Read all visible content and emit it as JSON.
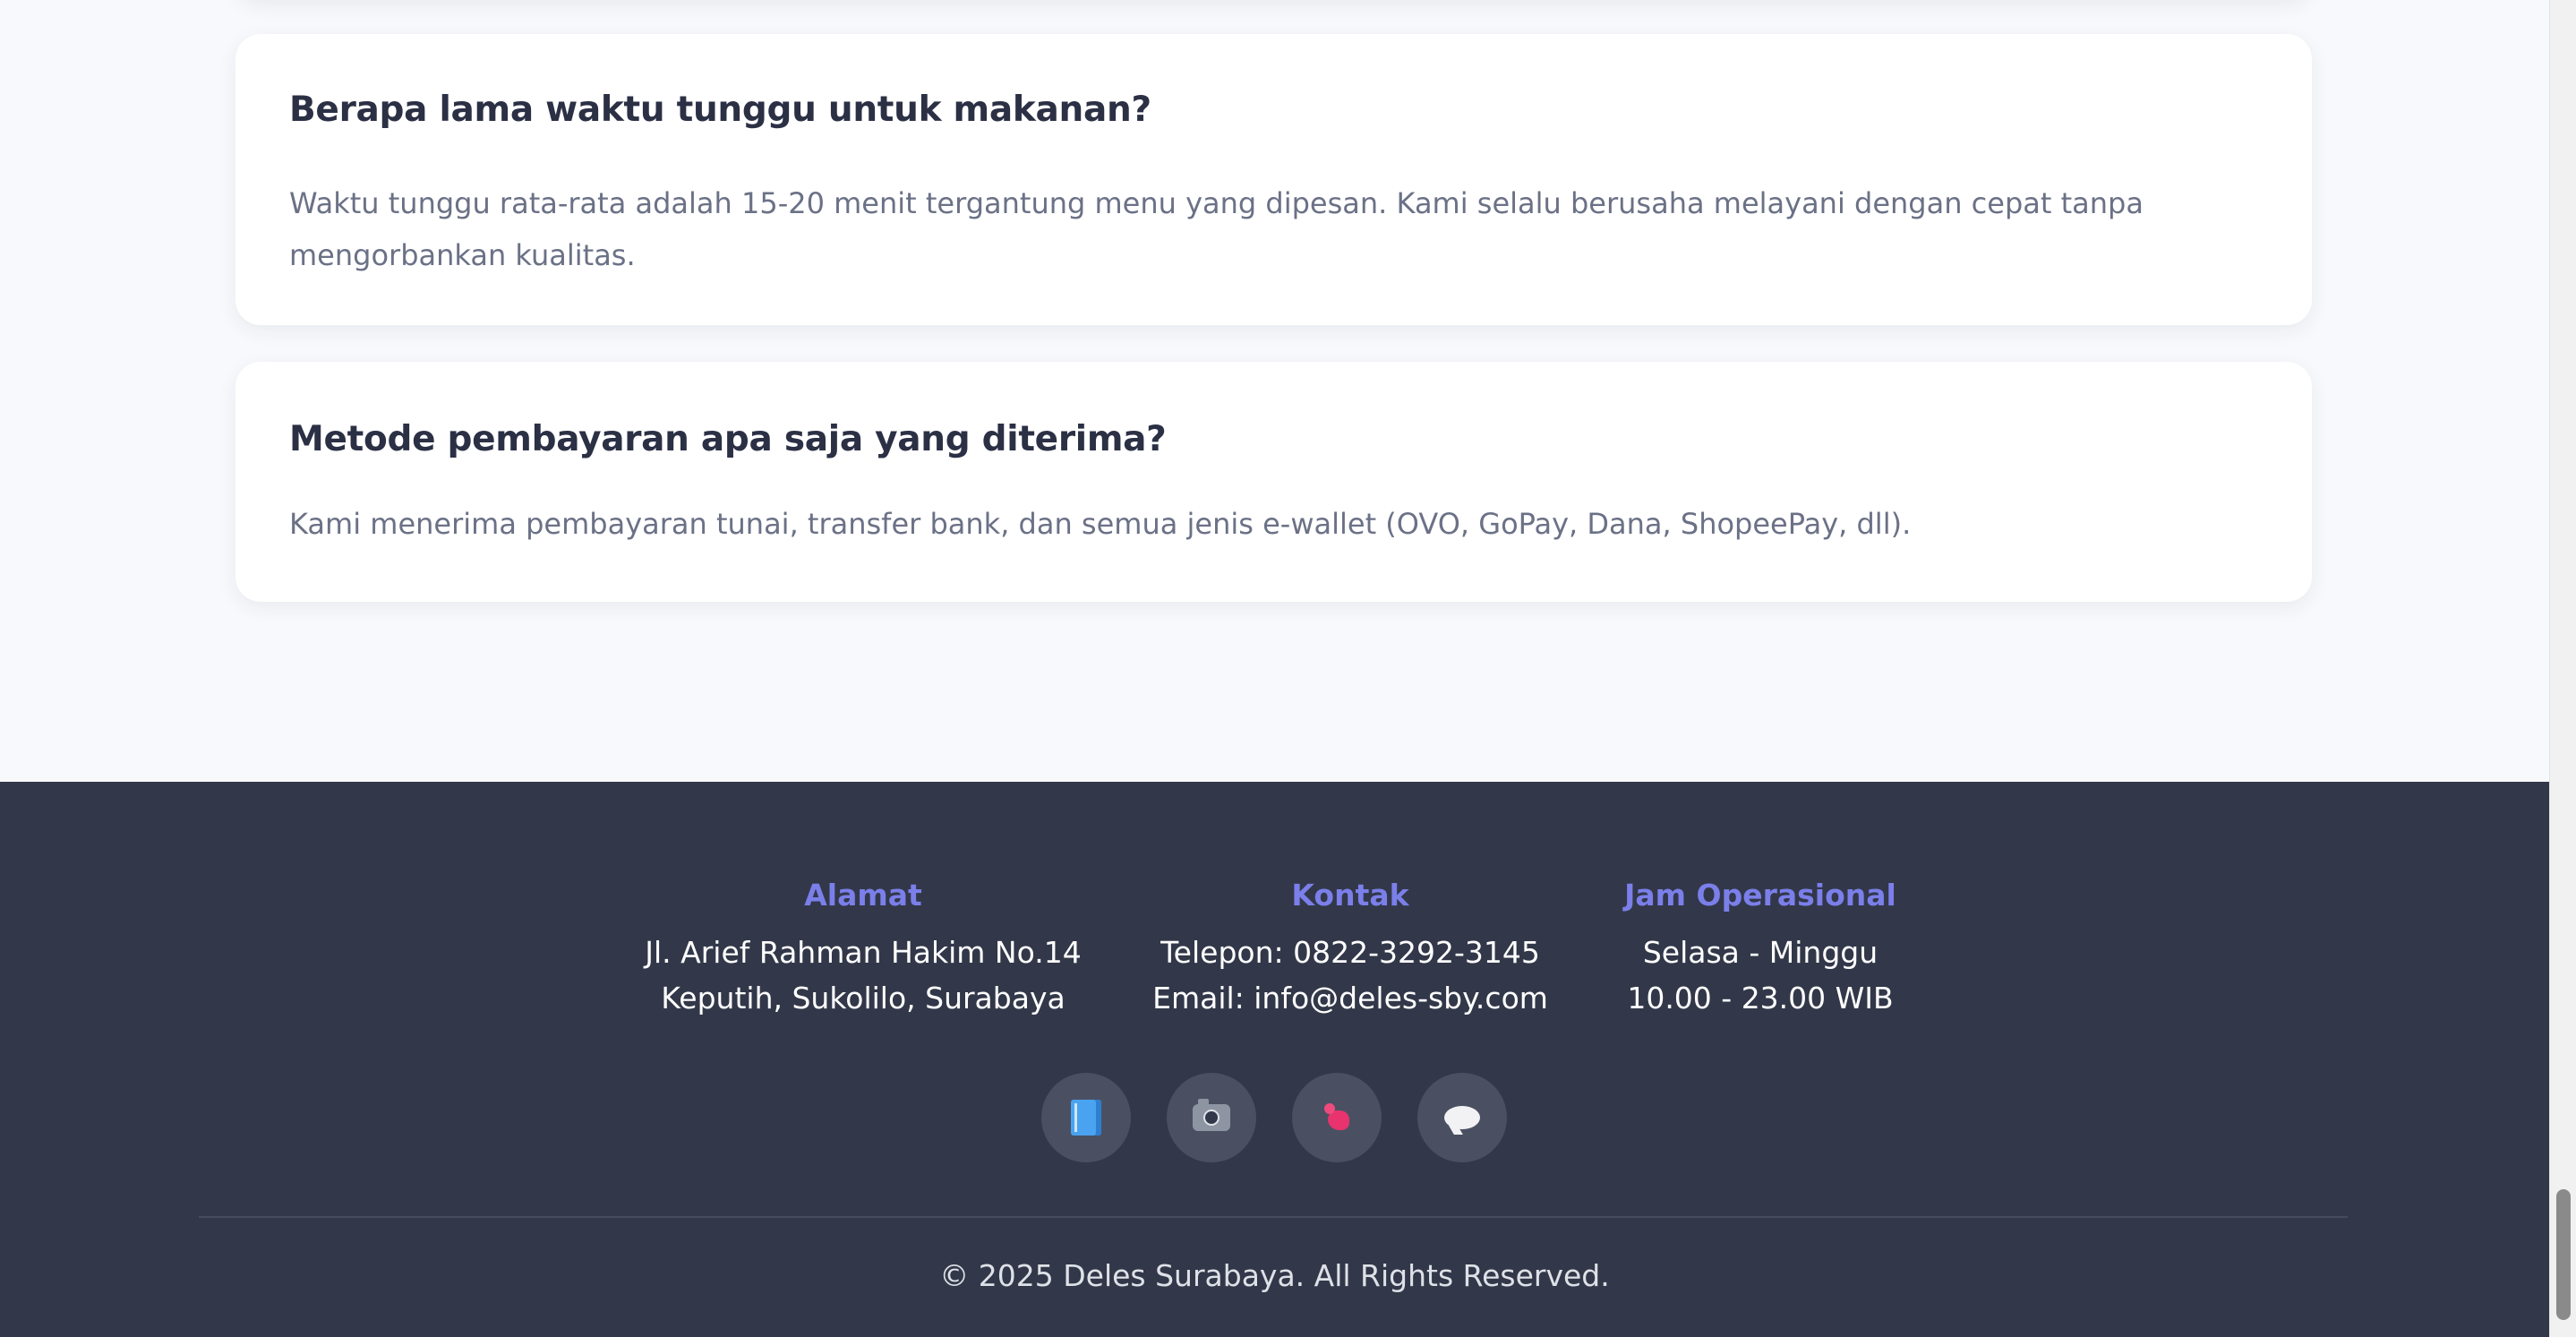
{
  "faq": {
    "items": [
      {
        "question": "Berapa lama waktu tunggu untuk makanan?",
        "answer": "Waktu tunggu rata-rata adalah 15-20 menit tergantung menu yang dipesan. Kami selalu berusaha melayani dengan cepat tanpa mengorbankan kualitas."
      },
      {
        "question": "Metode pembayaran apa saja yang diterima?",
        "answer": "Kami menerima pembayaran tunai, transfer bank, dan semua jenis e-wallet (OVO, GoPay, Dana, ShopeePay, dll)."
      }
    ]
  },
  "footer": {
    "alamat": {
      "title": "Alamat",
      "line1": "Jl. Arief Rahman Hakim No.14",
      "line2": "Keputih, Sukolilo, Surabaya"
    },
    "kontak": {
      "title": "Kontak",
      "line1": "Telepon: 0822-3292-3145",
      "line2": "Email: info@deles-sby.com"
    },
    "jam": {
      "title": "Jam Operasional",
      "line1": "Selasa - Minggu",
      "line2": "10.00 - 23.00 WIB"
    },
    "socials": [
      {
        "icon": "book-icon"
      },
      {
        "icon": "camera-icon"
      },
      {
        "icon": "bird-icon"
      },
      {
        "icon": "speech-bubble-icon"
      }
    ],
    "copyright": "© 2025 Deles Surabaya. All Rights Reserved."
  },
  "colors": {
    "page_bg": "#f8f9fc",
    "card_bg": "#ffffff",
    "heading": "#2b3045",
    "body_text": "#6b7186",
    "footer_bg": "#323849",
    "footer_accent": "#7b7fea",
    "footer_text": "#ffffff",
    "social_bg": "#4a5062"
  }
}
